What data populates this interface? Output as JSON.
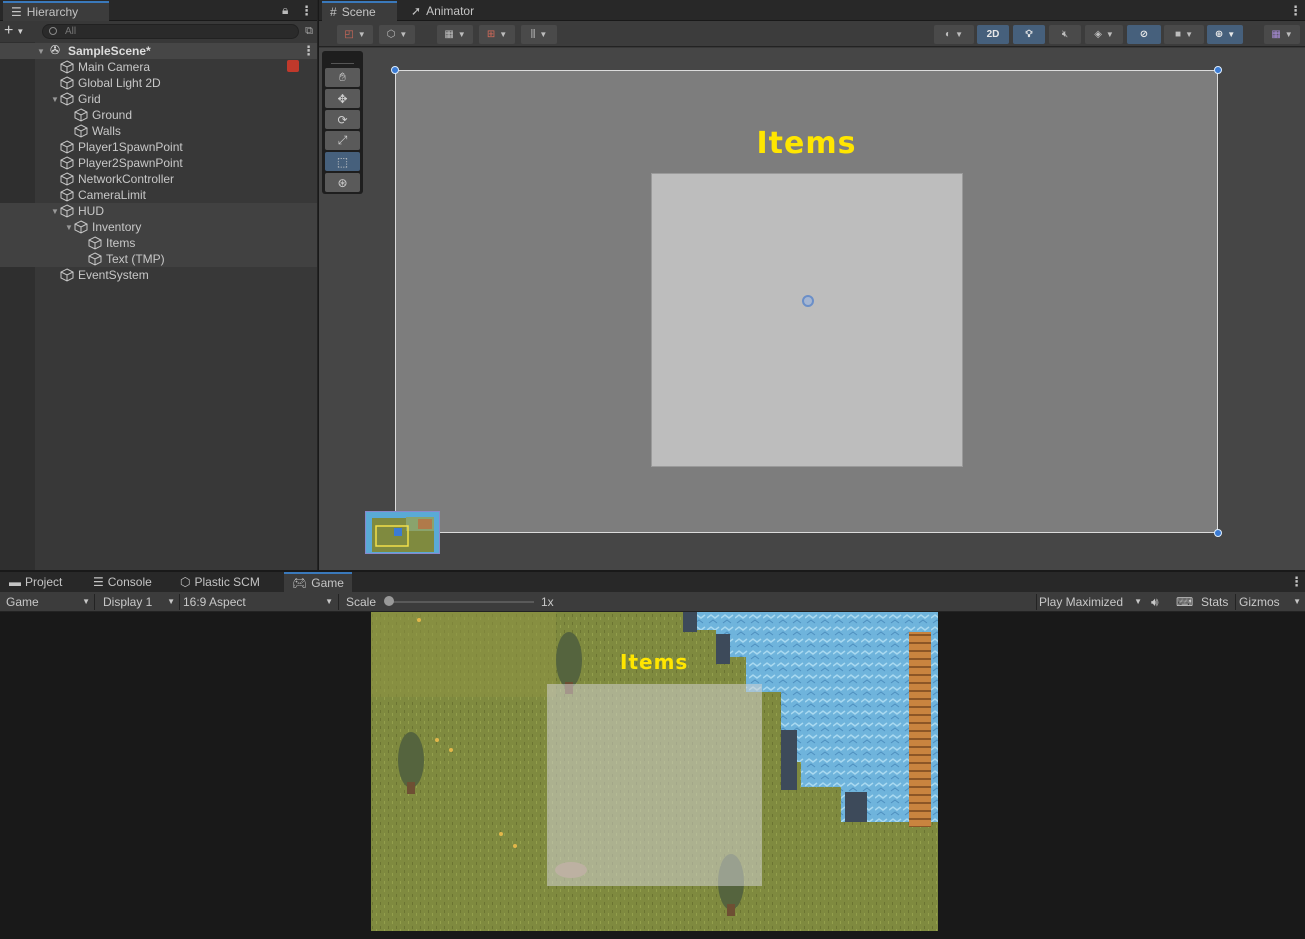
{
  "hierarchy": {
    "tab_label": "Hierarchy",
    "add_label": "+",
    "search_placeholder": "All",
    "scene_name": "SampleScene*",
    "items": [
      {
        "label": "Main Camera",
        "depth": 0,
        "expand": ""
      },
      {
        "label": "Global Light 2D",
        "depth": 0,
        "expand": ""
      },
      {
        "label": "Grid",
        "depth": 0,
        "expand": "▼"
      },
      {
        "label": "Ground",
        "depth": 1,
        "expand": ""
      },
      {
        "label": "Walls",
        "depth": 1,
        "expand": ""
      },
      {
        "label": "Player1SpawnPoint",
        "depth": 0,
        "expand": ""
      },
      {
        "label": "Player2SpawnPoint",
        "depth": 0,
        "expand": ""
      },
      {
        "label": "NetworkController",
        "depth": 0,
        "expand": ""
      },
      {
        "label": "CameraLimit",
        "depth": 0,
        "expand": ""
      },
      {
        "label": "HUD",
        "depth": 0,
        "expand": "▼"
      },
      {
        "label": "Inventory",
        "depth": 1,
        "expand": "▼"
      },
      {
        "label": "Items",
        "depth": 2,
        "expand": ""
      },
      {
        "label": "Text (TMP)",
        "depth": 2,
        "expand": ""
      },
      {
        "label": "EventSystem",
        "depth": 0,
        "expand": ""
      }
    ]
  },
  "scene": {
    "tabs": [
      {
        "label": "Scene"
      },
      {
        "label": "Animator"
      }
    ],
    "toolbar": {
      "mode_2d": "2D"
    },
    "canvas_title": "Items"
  },
  "game": {
    "tabs": [
      {
        "label": "Project"
      },
      {
        "label": "Console"
      },
      {
        "label": "Plastic SCM"
      },
      {
        "label": "Game"
      }
    ],
    "toolbar": {
      "view_select": "Game",
      "display_select": "Display 1",
      "aspect_select": "16:9 Aspect",
      "scale_label": "Scale",
      "scale_value": "1x",
      "play_mode": "Play Maximized",
      "stats_label": "Stats",
      "gizmos_label": "Gizmos"
    },
    "title": "Items"
  },
  "colors": {
    "accent": "#3a79bb",
    "title_yellow": "#ffe600",
    "grass": "#7f8a3f",
    "water": "#6fb4dc"
  }
}
